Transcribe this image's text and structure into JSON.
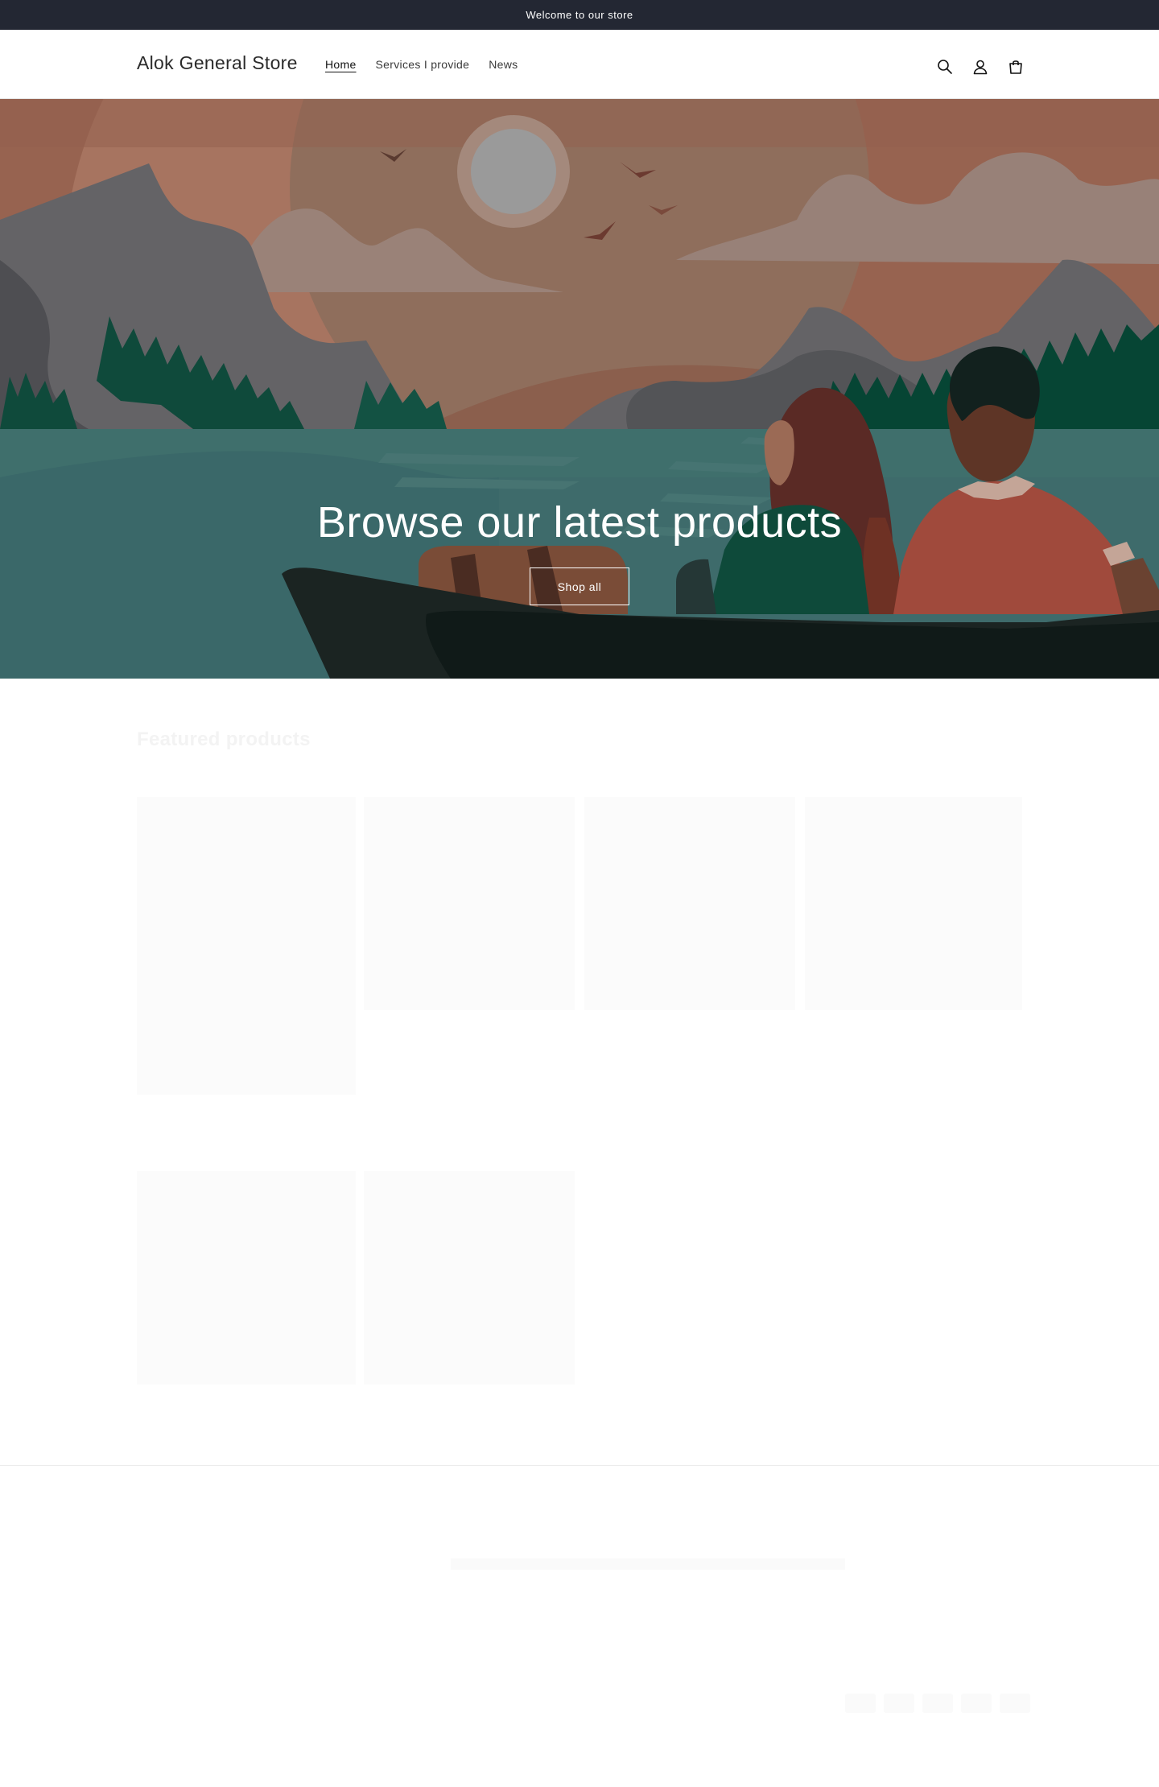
{
  "announcement": {
    "text": "Welcome to our store"
  },
  "header": {
    "store_name": "Alok General Store",
    "nav": [
      {
        "label": "Home",
        "active": true
      },
      {
        "label": "Services I provide",
        "active": false
      },
      {
        "label": "News",
        "active": false
      }
    ],
    "icons": [
      "search-icon",
      "account-icon",
      "cart-icon"
    ]
  },
  "hero": {
    "title": "Browse our latest products",
    "button_label": "Shop all"
  },
  "colors": {
    "announcement_bg": "#232733",
    "sky": "#8f6e5c",
    "water": "#3e6b6b",
    "trees": "#0e4a3a",
    "boat": "#1b2422"
  },
  "featured": {
    "title": "Featured products"
  }
}
